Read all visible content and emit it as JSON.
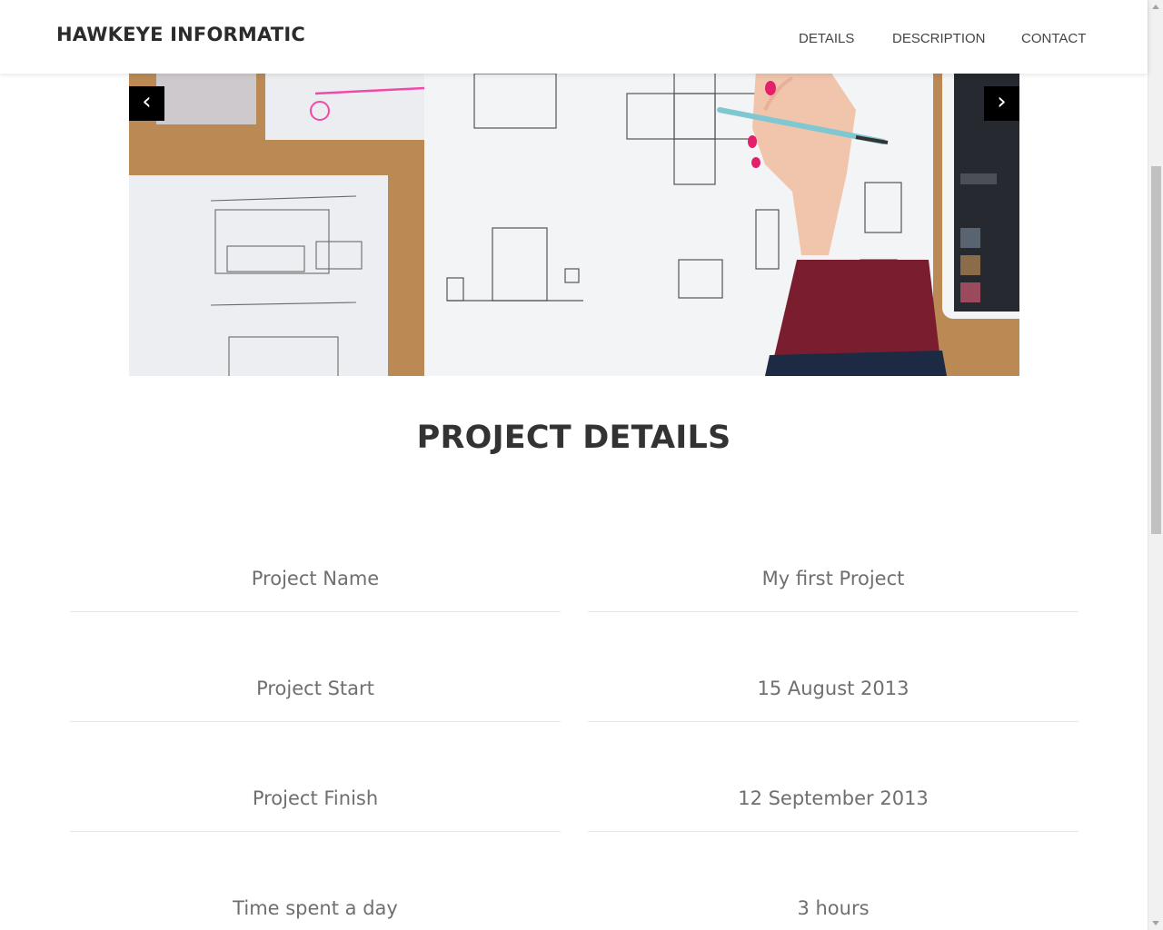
{
  "header": {
    "brand": "HAWKEYE INFORMATIC",
    "nav": [
      "DETAILS",
      "DESCRIPTION",
      "CONTACT"
    ]
  },
  "carousel": {
    "prev_label": "‹",
    "next_label": "›"
  },
  "section": {
    "title": "PROJECT DETAILS"
  },
  "details": [
    {
      "label": "Project Name",
      "value": "My first Project"
    },
    {
      "label": "Project Start",
      "value": "15 August 2013"
    },
    {
      "label": "Project Finish",
      "value": "12 September 2013"
    },
    {
      "label": "Time spent a day",
      "value": "3 hours"
    }
  ]
}
